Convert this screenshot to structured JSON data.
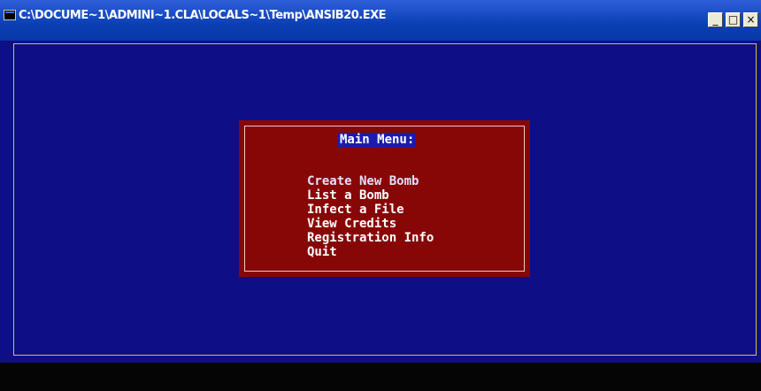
{
  "window": {
    "title": "C:\\DOCUME~1\\ADMINI~1.CLA\\LOCALS~1\\Temp\\ANSIB20.EXE",
    "icon": "console-icon",
    "buttons": {
      "minimize": "_",
      "restore": "□",
      "close": "×"
    }
  },
  "menu": {
    "title": "Main Menu:",
    "items": [
      "Create New Bomb",
      "List a Bomb",
      "Infect a File",
      "View Credits",
      "Registration Info",
      "Quit"
    ],
    "selected_index": 0
  },
  "colors": {
    "titlebar": "#0a3fb4",
    "console_background": "#0e0e87",
    "frame_border": "#d7c14a",
    "dialog_background": "#870707",
    "highlight": "#1b1bb0",
    "status_bar": "#050505"
  }
}
